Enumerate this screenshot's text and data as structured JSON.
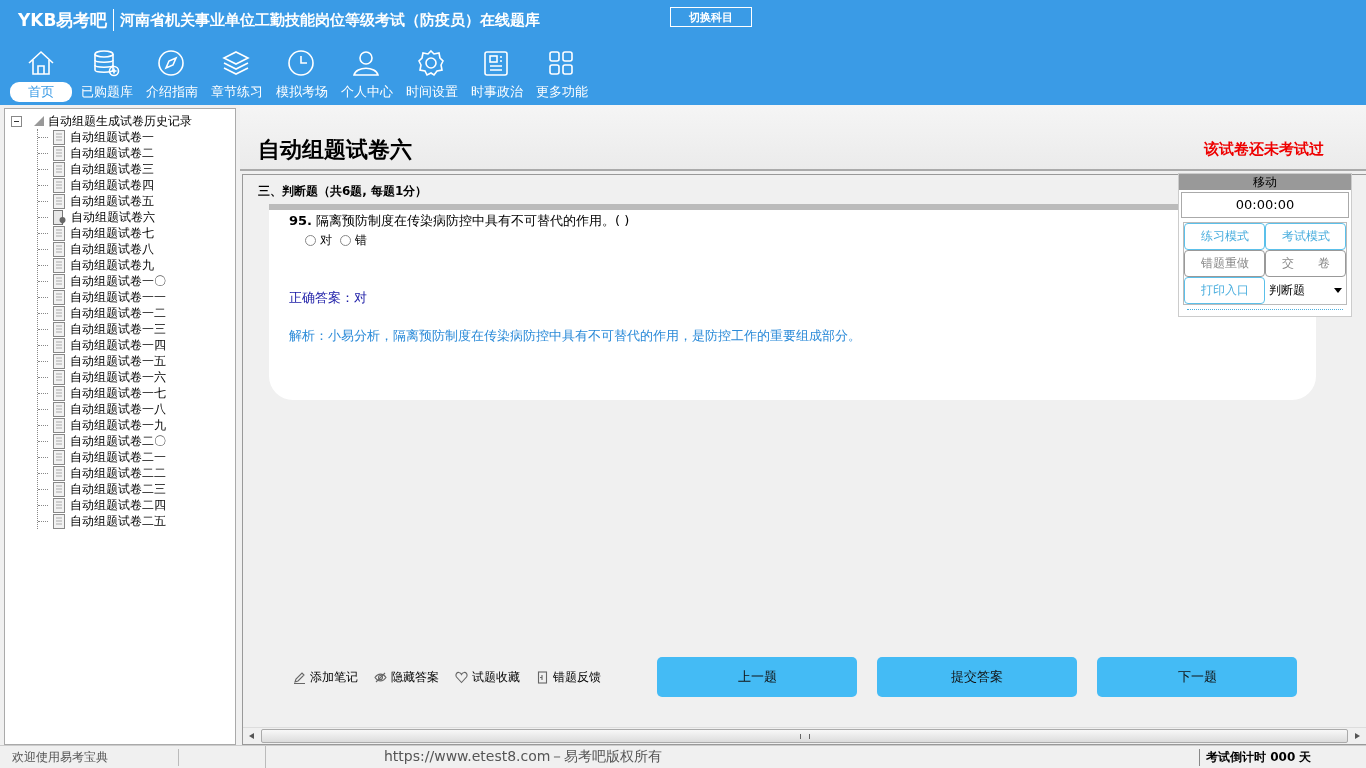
{
  "header": {
    "brand": "YKB易考吧",
    "title": "河南省机关事业单位工勤技能岗位等级考试（防疫员）在线题库",
    "switch_button": "切换科目"
  },
  "nav": [
    {
      "label": "首页",
      "selected": true
    },
    {
      "label": "已购题库",
      "selected": false
    },
    {
      "label": "介绍指南",
      "selected": false
    },
    {
      "label": "章节练习",
      "selected": false
    },
    {
      "label": "模拟考场",
      "selected": false
    },
    {
      "label": "个人中心",
      "selected": false
    },
    {
      "label": "时间设置",
      "selected": false
    },
    {
      "label": "时事政治",
      "selected": false
    },
    {
      "label": "更多功能",
      "selected": false
    }
  ],
  "tree": {
    "label": "自动组题生成试卷历史记录",
    "expanded": true,
    "children": [
      {
        "label": "自动组题试卷一",
        "current": false
      },
      {
        "label": "自动组题试卷二",
        "current": false
      },
      {
        "label": "自动组题试卷三",
        "current": false
      },
      {
        "label": "自动组题试卷四",
        "current": false
      },
      {
        "label": "自动组题试卷五",
        "current": false
      },
      {
        "label": "自动组题试卷六",
        "current": true
      },
      {
        "label": "自动组题试卷七",
        "current": false
      },
      {
        "label": "自动组题试卷八",
        "current": false
      },
      {
        "label": "自动组题试卷九",
        "current": false
      },
      {
        "label": "自动组题试卷一〇",
        "current": false
      },
      {
        "label": "自动组题试卷一一",
        "current": false
      },
      {
        "label": "自动组题试卷一二",
        "current": false
      },
      {
        "label": "自动组题试卷一三",
        "current": false
      },
      {
        "label": "自动组题试卷一四",
        "current": false
      },
      {
        "label": "自动组题试卷一五",
        "current": false
      },
      {
        "label": "自动组题试卷一六",
        "current": false
      },
      {
        "label": "自动组题试卷一七",
        "current": false
      },
      {
        "label": "自动组题试卷一八",
        "current": false
      },
      {
        "label": "自动组题试卷一九",
        "current": false
      },
      {
        "label": "自动组题试卷二〇",
        "current": false
      },
      {
        "label": "自动组题试卷二一",
        "current": false
      },
      {
        "label": "自动组题试卷二二",
        "current": false
      },
      {
        "label": "自动组题试卷二三",
        "current": false
      },
      {
        "label": "自动组题试卷二四",
        "current": false
      },
      {
        "label": "自动组题试卷二五",
        "current": false
      }
    ]
  },
  "paper": {
    "title": "自动组题试卷六",
    "status": "该试卷还未考试过"
  },
  "section": "三、判断题（共6题, 每题1分）",
  "question": {
    "number": "95.",
    "text": "隔离预防制度在传染病防控中具有不可替代的作用。( )",
    "options": [
      {
        "label": "对",
        "selected": false
      },
      {
        "label": "错",
        "selected": false
      }
    ],
    "answer": "正确答案：对",
    "analysis": "解析：小易分析，隔离预防制度在传染病防控中具有不可替代的作用，是防控工作的重要组成部分。"
  },
  "tools": [
    "添加笔记",
    "隐藏答案",
    "试题收藏",
    "错题反馈"
  ],
  "nav_buttons": [
    "上一题",
    "提交答案",
    "下一题"
  ],
  "panel": {
    "handle": "移动",
    "timer": "00:00:00",
    "buttons": [
      {
        "label": "练习模式",
        "kind": "blue"
      },
      {
        "label": "考试模式",
        "kind": "blue"
      },
      {
        "label": "错题重做",
        "kind": "grey"
      },
      {
        "label": "交　　卷",
        "kind": "grey"
      },
      {
        "label": "打印入口",
        "kind": "blue"
      }
    ],
    "type_select": "判断题"
  },
  "status_bar": {
    "welcome": "欢迎使用易考宝典",
    "copyright": "https://www.etest8.com－易考吧版权所有",
    "countdown": "考试倒计时 000 天"
  }
}
